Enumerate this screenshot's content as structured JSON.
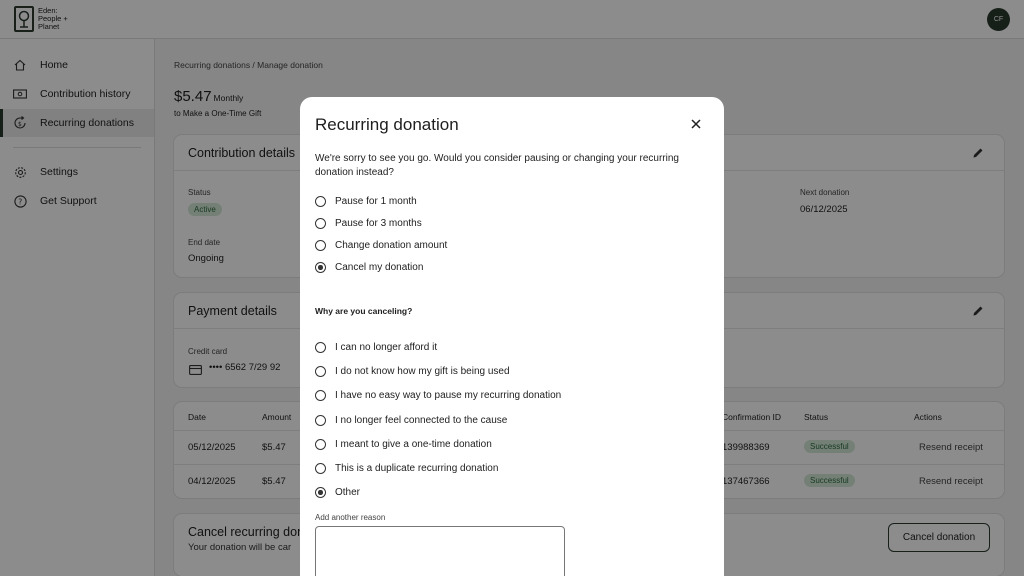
{
  "header": {
    "logo_lines": [
      "Eden:",
      "People +",
      "Planet"
    ],
    "avatar_initials": "CF"
  },
  "sidebar": {
    "items": [
      {
        "label": "Home",
        "icon": "home-icon"
      },
      {
        "label": "Contribution history",
        "icon": "money-icon"
      },
      {
        "label": "Recurring donations",
        "icon": "recurring-icon"
      },
      {
        "label": "Settings",
        "icon": "gear-icon"
      },
      {
        "label": "Get Support",
        "icon": "help-icon"
      }
    ],
    "active_index": 2
  },
  "main": {
    "breadcrumb": "Recurring donations  /  Manage donation",
    "amount": "$5.47",
    "frequency": "Monthly",
    "one_time_link": "to Make a One-Time Gift",
    "contribution": {
      "title": "Contribution details",
      "status_label": "Status",
      "status_value": "Active",
      "next_label": "Next donation",
      "next_value": "06/12/2025",
      "end_label": "End date",
      "end_value": "Ongoing"
    },
    "payment": {
      "title": "Payment details",
      "card_label": "Credit card",
      "card_value": "•••• 6562  7/29  92"
    },
    "table": {
      "headers": {
        "date": "Date",
        "amount": "Amount",
        "confirmation": "Confirmation ID",
        "status": "Status",
        "actions": "Actions"
      },
      "rows": [
        {
          "date": "05/12/2025",
          "amount": "$5.47",
          "confirmation": "139988369",
          "status": "Successful",
          "action": "Resend receipt"
        },
        {
          "date": "04/12/2025",
          "amount": "$5.47",
          "confirmation": "137467366",
          "status": "Successful",
          "action": "Resend receipt"
        }
      ]
    },
    "cancel_card": {
      "title": "Cancel recurring dor",
      "subtitle": "Your donation will be car",
      "button": "Cancel donation"
    }
  },
  "modal": {
    "title": "Recurring donation",
    "message": "We're sorry to see you go. Would you consider pausing or changing your recurring donation instead?",
    "options": [
      {
        "label": "Pause for 1 month",
        "selected": false
      },
      {
        "label": "Pause for 3 months",
        "selected": false
      },
      {
        "label": "Change donation amount",
        "selected": false
      },
      {
        "label": "Cancel my donation",
        "selected": true
      }
    ],
    "reason_heading": "Why are you canceling?",
    "reasons": [
      {
        "label": "I can no longer afford it",
        "selected": false
      },
      {
        "label": "I do not know how my gift is being used",
        "selected": false
      },
      {
        "label": "I have no easy way to pause my recurring donation",
        "selected": false
      },
      {
        "label": "I no longer feel connected to the cause",
        "selected": false
      },
      {
        "label": "I meant to give a one-time donation",
        "selected": false
      },
      {
        "label": "This is a duplicate recurring donation",
        "selected": false
      },
      {
        "label": "Other",
        "selected": true
      }
    ],
    "add_reason_label": "Add another reason",
    "add_reason_value": ""
  }
}
